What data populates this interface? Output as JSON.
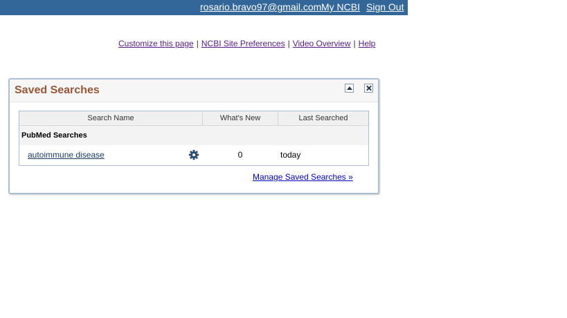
{
  "topbar": {
    "email": "rosario.bravo97@gmail.com",
    "my_ncbi": "My NCBI",
    "sign_out": "Sign Out"
  },
  "links": {
    "customize": "Customize this page",
    "site_prefs": "NCBI Site Preferences",
    "video": "Video Overview",
    "help": "Help",
    "separator": "|"
  },
  "panel": {
    "title": "Saved Searches",
    "collapse_icon": "collapse-icon",
    "close_icon": "close-icon",
    "columns": {
      "name": "Search Name",
      "whats_new": "What's New",
      "last_searched": "Last Searched"
    },
    "group": "PubMed Searches",
    "rows": [
      {
        "name": "autoimmune disease",
        "settings_icon": "gear-icon",
        "whats_new": "0",
        "last_searched": "today"
      }
    ],
    "manage_link": "Manage Saved Searches »"
  },
  "colors": {
    "topbar_bg": "#336699",
    "title": "#985735",
    "link": "#551a8b",
    "border": "#a9bfd6"
  }
}
